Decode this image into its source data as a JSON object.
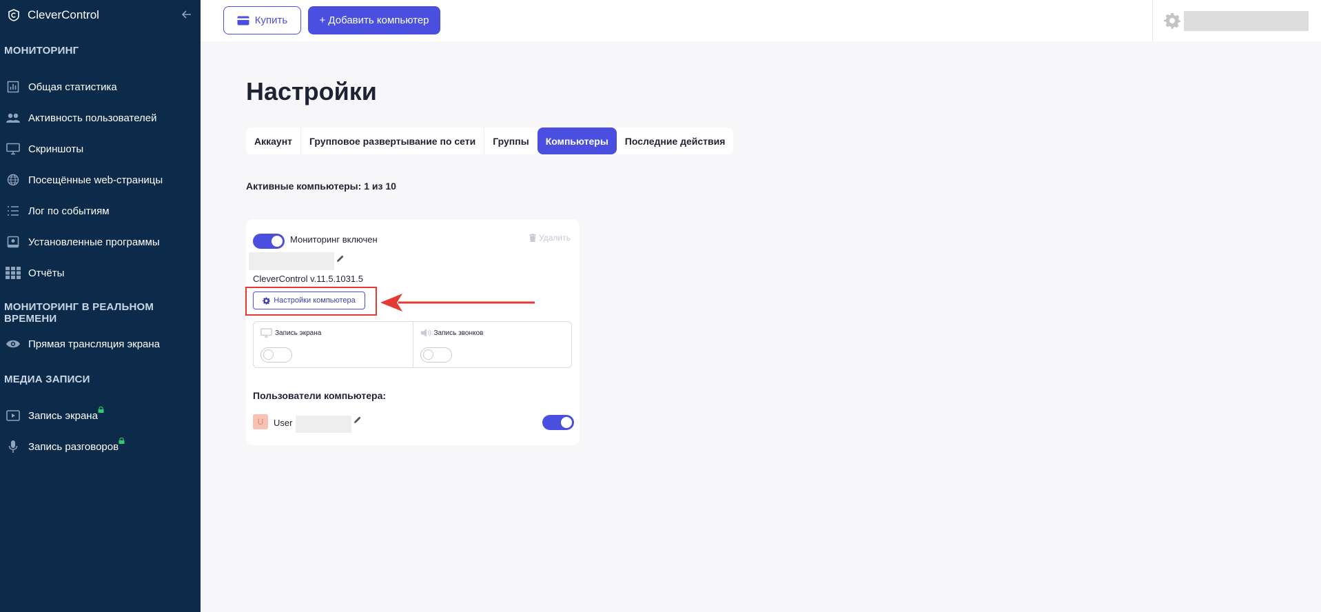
{
  "sidebar": {
    "brand": "CleverControl",
    "sections": {
      "monitoring": "МОНИТОРИНГ",
      "realtime": "МОНИТОРИНГ В РЕАЛЬНОМ ВРЕМЕНИ",
      "media": "МЕДИА ЗАПИСИ"
    },
    "items": [
      {
        "label": "Общая статистика",
        "icon": "bar-chart-icon"
      },
      {
        "label": "Активность пользователей",
        "icon": "users-icon"
      },
      {
        "label": "Скриншоты",
        "icon": "monitor-icon"
      },
      {
        "label": "Посещённые web-страницы",
        "icon": "globe-icon"
      },
      {
        "label": "Лог по событиям",
        "icon": "list-icon"
      },
      {
        "label": "Установленные программы",
        "icon": "install-icon"
      },
      {
        "label": "Отчёты",
        "icon": "grid-icon"
      },
      {
        "label": "Прямая трансляция экрана",
        "icon": "eye-icon"
      },
      {
        "label": "Запись экрана",
        "icon": "play-screen-icon"
      },
      {
        "label": "Запись разговоров",
        "icon": "microphone-icon"
      }
    ]
  },
  "toolbar": {
    "buy_label": "Купить",
    "add_label": "+ Добавить компьютер"
  },
  "page": {
    "title": "Настройки",
    "tabs": [
      {
        "label": "Аккаунт",
        "active": false
      },
      {
        "label": "Групповое развертывание по сети",
        "active": false
      },
      {
        "label": "Группы",
        "active": false
      },
      {
        "label": "Компьютеры",
        "active": true
      },
      {
        "label": "Последние действия",
        "active": false
      }
    ],
    "active_computers": "Активные компьютеры: 1 из 10"
  },
  "computer_card": {
    "monitoring_label": "Мониторинг включен",
    "monitoring_enabled": true,
    "delete_label": "Удалить",
    "version": "CleverControl v.11.5.1031.5",
    "settings_button": "Настройки компьютера",
    "features": [
      {
        "label": "Запись экрана",
        "enabled": false,
        "icon": "monitor-icon"
      },
      {
        "label": "Запись звонков",
        "enabled": false,
        "icon": "speaker-icon"
      }
    ],
    "users_title": "Пользователи компьютера:",
    "users": [
      {
        "avatar_letter": "U",
        "name": "User",
        "enabled": true
      }
    ]
  },
  "colors": {
    "sidebar_bg": "#0c2a4a",
    "accent": "#4a4fe0",
    "annotation": "#e53935"
  }
}
